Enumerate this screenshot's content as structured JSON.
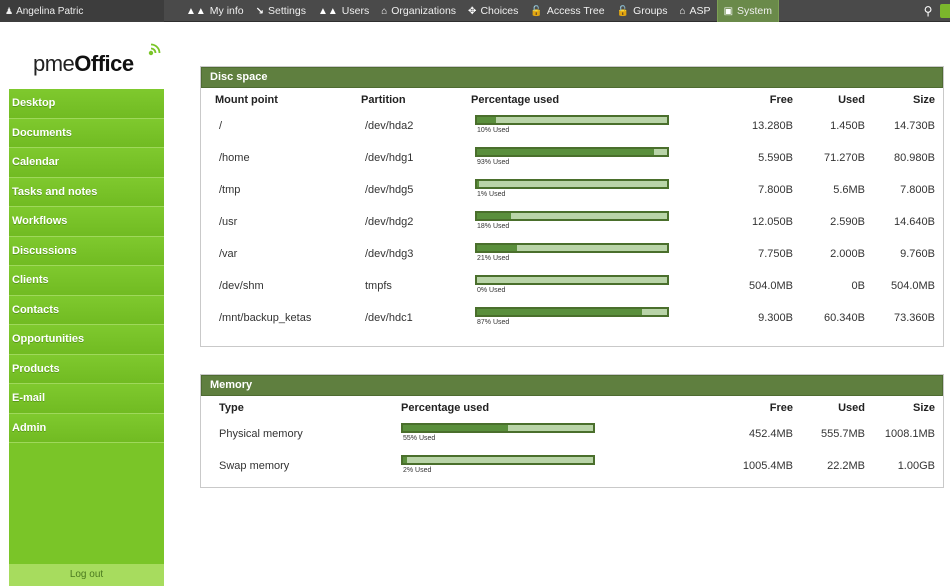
{
  "topbar": {
    "user_name": "Angelina Patric",
    "nav": [
      {
        "label": "My info",
        "icon": "users-icon",
        "glyph": "▲▲"
      },
      {
        "label": "Settings",
        "icon": "wrench-icon",
        "glyph": "↘"
      },
      {
        "label": "Users",
        "icon": "users-icon",
        "glyph": "▲▲"
      },
      {
        "label": "Organizations",
        "icon": "building-icon",
        "glyph": "⌂"
      },
      {
        "label": "Choices",
        "icon": "move-icon",
        "glyph": "✥"
      },
      {
        "label": "Access Tree",
        "icon": "lock-icon",
        "glyph": "🔓"
      },
      {
        "label": "Groups",
        "icon": "lock-icon",
        "glyph": "🔓"
      },
      {
        "label": "ASP",
        "icon": "building-icon",
        "glyph": "⌂"
      },
      {
        "label": "System",
        "icon": "monitor-icon",
        "glyph": "▣",
        "active": true
      }
    ]
  },
  "sidebar": {
    "logo_text_light": "pme",
    "logo_text_bold": "Office",
    "items": [
      "Desktop",
      "Documents",
      "Calendar",
      "Tasks and notes",
      "Workflows",
      "Discussions",
      "Clients",
      "Contacts",
      "Opportunities",
      "Products",
      "E-mail",
      "Admin"
    ],
    "logout": "Log out"
  },
  "disc": {
    "title": "Disc space",
    "headers": {
      "mount": "Mount point",
      "partition": "Partition",
      "pct": "Percentage used",
      "free": "Free",
      "used": "Used",
      "size": "Size"
    },
    "rows": [
      {
        "mount": "/",
        "partition": "/dev/hda2",
        "pct": 10,
        "pct_label": "10% Used",
        "free": "13.280B",
        "used": "1.450B",
        "size": "14.730B"
      },
      {
        "mount": "/home",
        "partition": "/dev/hdg1",
        "pct": 93,
        "pct_label": "93% Used",
        "free": "5.590B",
        "used": "71.270B",
        "size": "80.980B"
      },
      {
        "mount": "/tmp",
        "partition": "/dev/hdg5",
        "pct": 1,
        "pct_label": "1% Used",
        "free": "7.800B",
        "used": "5.6MB",
        "size": "7.800B"
      },
      {
        "mount": "/usr",
        "partition": "/dev/hdg2",
        "pct": 18,
        "pct_label": "18% Used",
        "free": "12.050B",
        "used": "2.590B",
        "size": "14.640B"
      },
      {
        "mount": "/var",
        "partition": "/dev/hdg3",
        "pct": 21,
        "pct_label": "21% Used",
        "free": "7.750B",
        "used": "2.000B",
        "size": "9.760B"
      },
      {
        "mount": "/dev/shm",
        "partition": "tmpfs",
        "pct": 0,
        "pct_label": "0% Used",
        "free": "504.0MB",
        "used": "0B",
        "size": "504.0MB"
      },
      {
        "mount": "/mnt/backup_ketas",
        "partition": "/dev/hdc1",
        "pct": 87,
        "pct_label": "87% Used",
        "free": "9.300B",
        "used": "60.340B",
        "size": "73.360B"
      }
    ]
  },
  "memory": {
    "title": "Memory",
    "headers": {
      "type": "Type",
      "pct": "Percentage used",
      "free": "Free",
      "used": "Used",
      "size": "Size"
    },
    "rows": [
      {
        "type": "Physical memory",
        "pct": 55,
        "pct_label": "55% Used",
        "free": "452.4MB",
        "used": "555.7MB",
        "size": "1008.1MB"
      },
      {
        "type": "Swap memory",
        "pct": 2,
        "pct_label": "2% Used",
        "free": "1005.4MB",
        "used": "22.2MB",
        "size": "1.00GB"
      }
    ]
  }
}
